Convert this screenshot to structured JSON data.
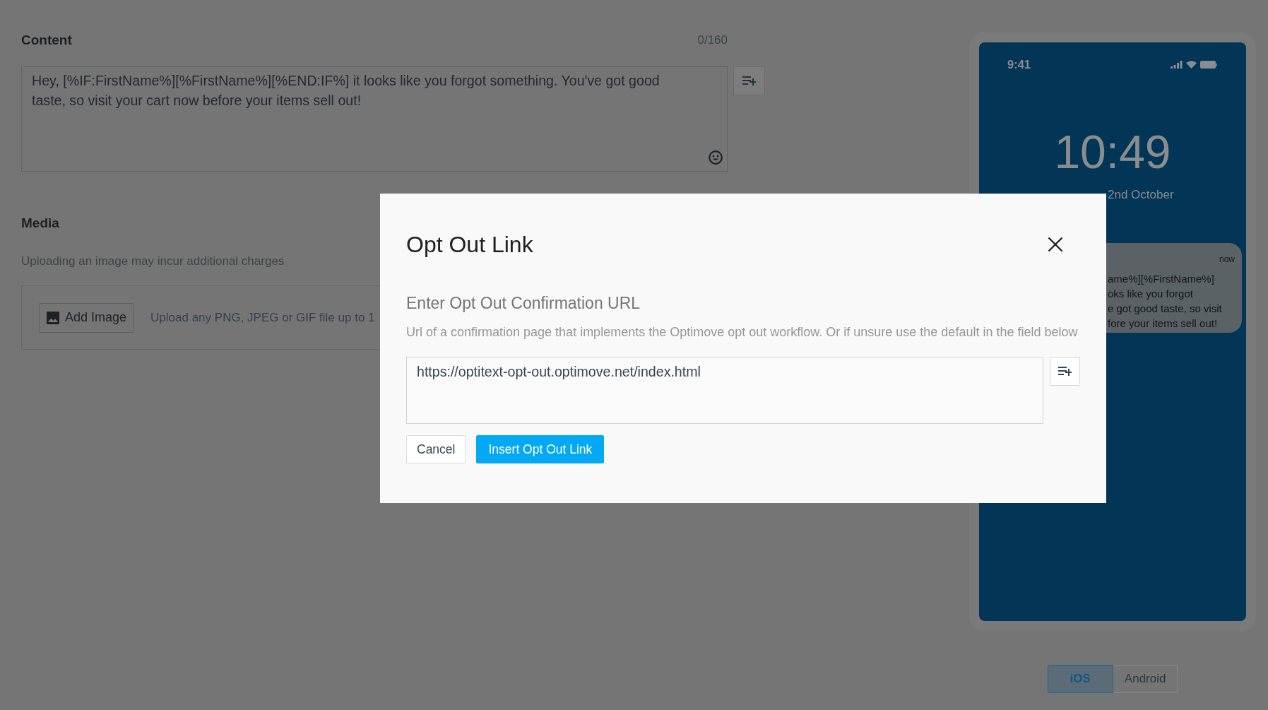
{
  "content": {
    "label": "Content",
    "counter": "0/160",
    "message": "Hey, [%IF:FirstName%][%FirstName%][%END:IF%] it looks like you forgot something. You've got good taste, so visit your cart now before your items sell out!"
  },
  "media": {
    "label": "Media",
    "hint": "Uploading an image may incur additional charges",
    "add_button": "Add Image",
    "note": "Upload any PNG, JPEG or GIF file up to 1"
  },
  "preview": {
    "status_time": "9:41",
    "clock": "10:49",
    "date": "2nd October",
    "notification": {
      "time": "now",
      "lines": [
        "ame%][%FirstName%]",
        "oks like you forgot",
        "e got good taste, so visit",
        "fore your items sell out!"
      ]
    },
    "platforms": [
      {
        "label": "iOS",
        "selected": true
      },
      {
        "label": "Android",
        "selected": false
      }
    ]
  },
  "dialog": {
    "title": "Opt Out Link",
    "heading": "Enter Opt Out Confirmation URL",
    "description": "Url of a confirmation page that implements the Optimove opt out workflow. Or if unsure use the default in the field below",
    "url": "https://optitext-opt-out.optimove.net/index.html",
    "buttons": [
      {
        "label": "Cancel",
        "kind": "cancel"
      },
      {
        "label": "Insert Opt Out Link",
        "kind": "confirm"
      }
    ]
  }
}
